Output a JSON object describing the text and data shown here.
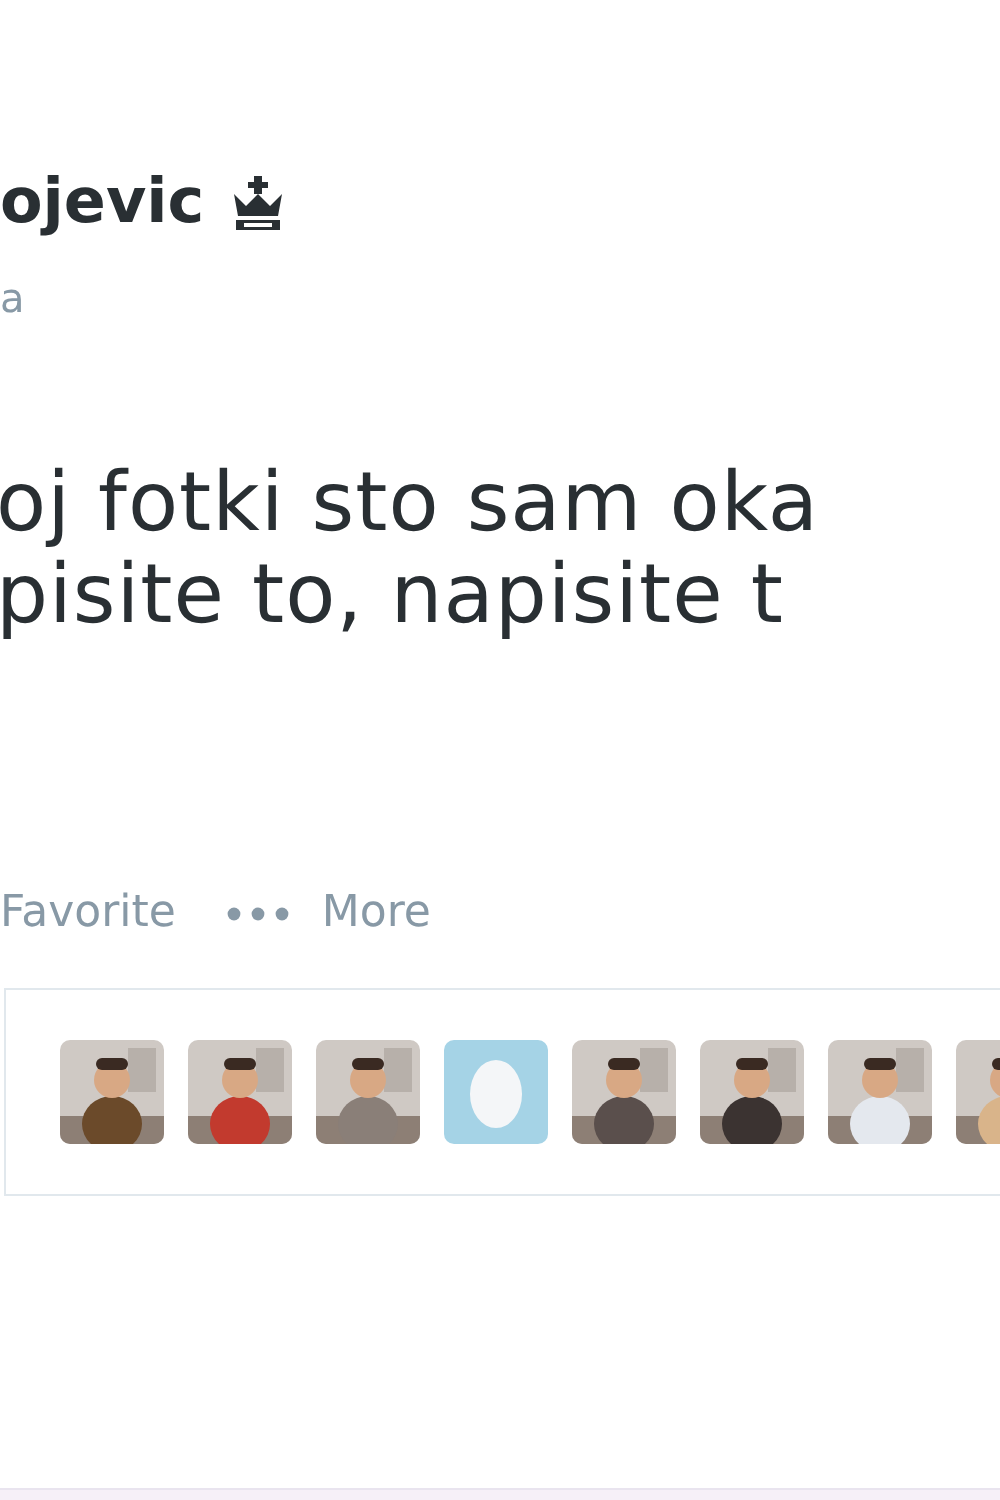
{
  "author": {
    "name": "ojevic",
    "handle": "a"
  },
  "tweet": {
    "lines": [
      "oj fotki sto sam oka",
      "pisite to, napisite t"
    ]
  },
  "actions": [
    {
      "kind": "favorite",
      "label": "Favorite"
    },
    {
      "kind": "more",
      "label": "More"
    }
  ],
  "favorited_by": [
    {
      "kind": "picture"
    },
    {
      "kind": "picture"
    },
    {
      "kind": "picture"
    },
    {
      "kind": "egg"
    },
    {
      "kind": "picture"
    },
    {
      "kind": "picture"
    },
    {
      "kind": "picture"
    },
    {
      "kind": "picture"
    }
  ]
}
